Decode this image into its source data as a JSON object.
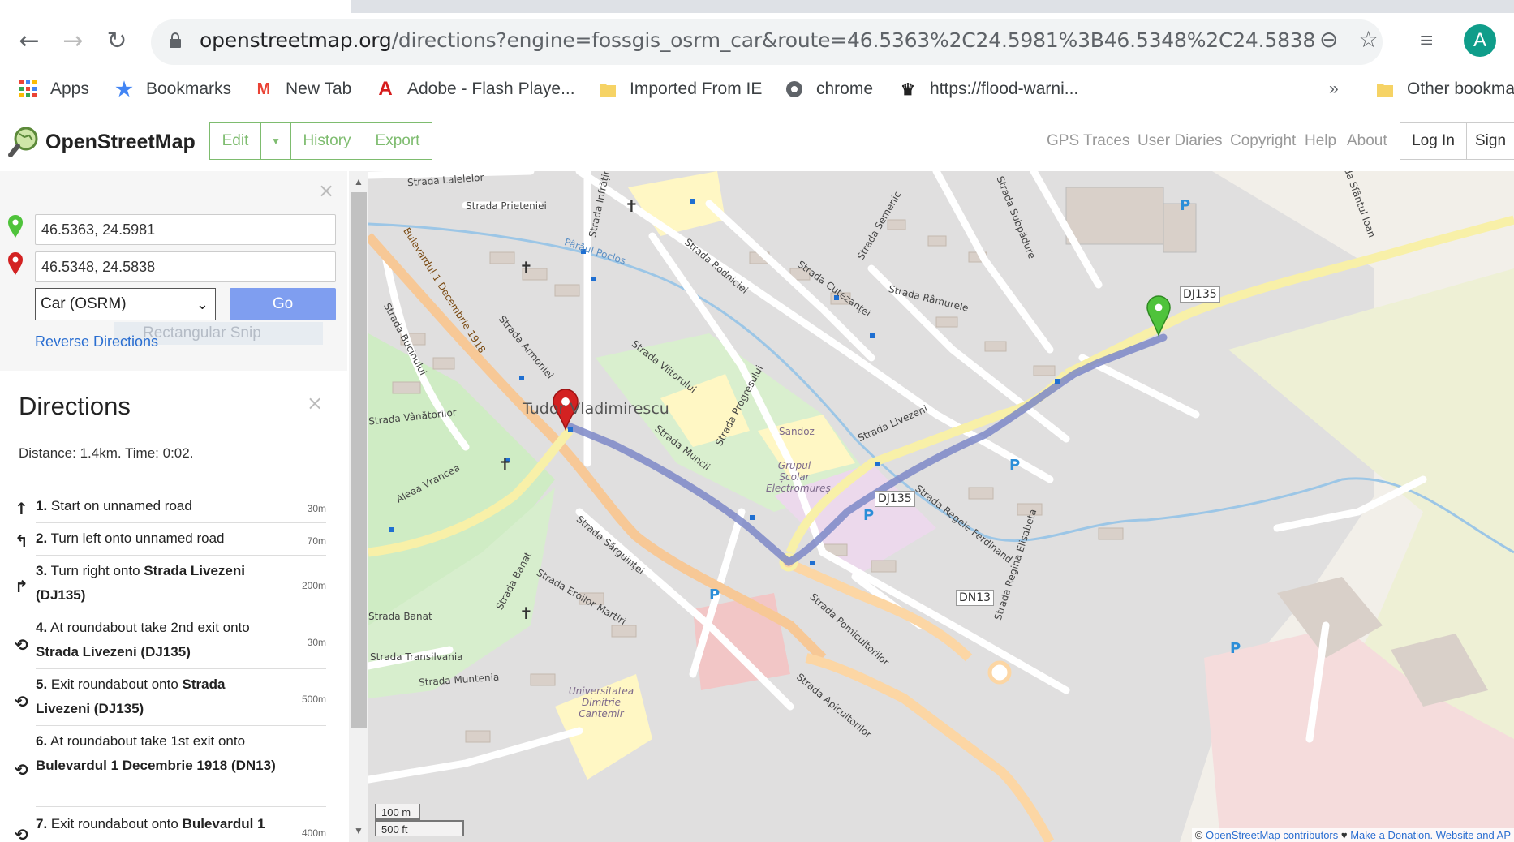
{
  "browser": {
    "url_host": "openstreetmap.org",
    "url_path": "/directions?engine=fossgis_osrm_car&route=46.5363%2C24.5981%3B46.5348%2C24.5838",
    "avatar_letter": "A"
  },
  "bookmarks": [
    {
      "label": "Apps"
    },
    {
      "label": "Bookmarks"
    },
    {
      "label": "New Tab"
    },
    {
      "label": "Adobe - Flash Playe..."
    },
    {
      "label": "Imported From IE"
    },
    {
      "label": "chrome"
    },
    {
      "label": "https://flood-warni..."
    },
    {
      "label": "Other bookma"
    }
  ],
  "bookmarks_overflow": "»",
  "osm": {
    "title": "OpenStreetMap",
    "edit": "Edit",
    "history": "History",
    "export": "Export",
    "nav": [
      "GPS Traces",
      "User Diaries",
      "Copyright",
      "Help",
      "About"
    ],
    "login": "Log In",
    "signup": "Sign"
  },
  "route": {
    "from": "46.5363, 24.5981",
    "to": "46.5348, 24.5838",
    "engine": "Car (OSRM)",
    "go": "Go",
    "reverse": "Reverse Directions",
    "snip_ghost": "Rectangular Snip"
  },
  "directions": {
    "title": "Directions",
    "summary": "Distance: 1.4km. Time: 0:02.",
    "steps": [
      {
        "num": "1.",
        "text": "Start on unnamed road",
        "bold": "",
        "dist": "30m",
        "icon": "straight-icon"
      },
      {
        "num": "2.",
        "text": "Turn left onto unnamed road",
        "bold": "",
        "dist": "70m",
        "icon": "turn-left-icon"
      },
      {
        "num": "3.",
        "text": "Turn right onto ",
        "bold": "Strada Livezeni (DJ135)",
        "dist": "200m",
        "icon": "turn-right-icon"
      },
      {
        "num": "4.",
        "text": "At roundabout take 2nd exit onto ",
        "bold": "Strada Livezeni (DJ135)",
        "dist": "30m",
        "icon": "roundabout-icon"
      },
      {
        "num": "5.",
        "text": "Exit roundabout onto ",
        "bold": "Strada Livezeni (DJ135)",
        "dist": "500m",
        "icon": "roundabout-icon"
      },
      {
        "num": "6.",
        "text": "At roundabout take 1st exit onto ",
        "bold": "Bulevardul 1 Decembrie 1918 (DN13)",
        "dist": "",
        "icon": "roundabout-icon"
      },
      {
        "num": "7.",
        "text": "Exit roundabout onto ",
        "bold": "Bulevardul 1",
        "dist": "400m",
        "icon": "roundabout-icon"
      }
    ]
  },
  "map": {
    "place_label": "Tudor Vladimirescu",
    "streets": [
      "Strada Lalelelor",
      "Strada Prieteniei",
      "Pârâul Poclos",
      "Strada Infrățirii",
      "Strada Rodniciei",
      "Strada Cutezanței",
      "Strada Râmurele",
      "Strada Semenic",
      "Strada Subpădure",
      "Bulevardul 1 Decembrie 1918",
      "Strada Bucinului",
      "Strada Armoniei",
      "Strada Vânătorilor",
      "Strada Viitorului",
      "Strada Progresului",
      "Strada Muncii",
      "Strada Livezeni",
      "Aleea Vrancea",
      "Strada Sărguinței",
      "Strada Banat",
      "Strada Banat",
      "Strada Eroilor Martiri",
      "Strada Transilvania",
      "Strada Muntenia",
      "Strada Pomicultorilor",
      "Strada Apicultorilor",
      "Strada Regele Ferdinand",
      "Strada Regina Elisabeta",
      "Strada Sfântul Ioan"
    ],
    "pois": [
      "Sandoz",
      "Grupul Școlar Electromureș",
      "Universitatea Dimitrie Cantemir"
    ],
    "shields": [
      "DJ135",
      "DJ135",
      "DN13"
    ],
    "scale_m": "100 m",
    "scale_ft": "500 ft",
    "attribution_prefix": "© ",
    "attribution_osm": "OpenStreetMap contributors",
    "attribution_heart": " ♥ ",
    "attribution_donate": "Make a Donation",
    "attribution_rest": ". Website and AP"
  },
  "colors": {
    "osm_green": "#7ebc6f",
    "route_line": "#7c88c8",
    "go_button": "#7f9ef0",
    "start_pin": "#4fc33b",
    "end_pin": "#d32222"
  }
}
